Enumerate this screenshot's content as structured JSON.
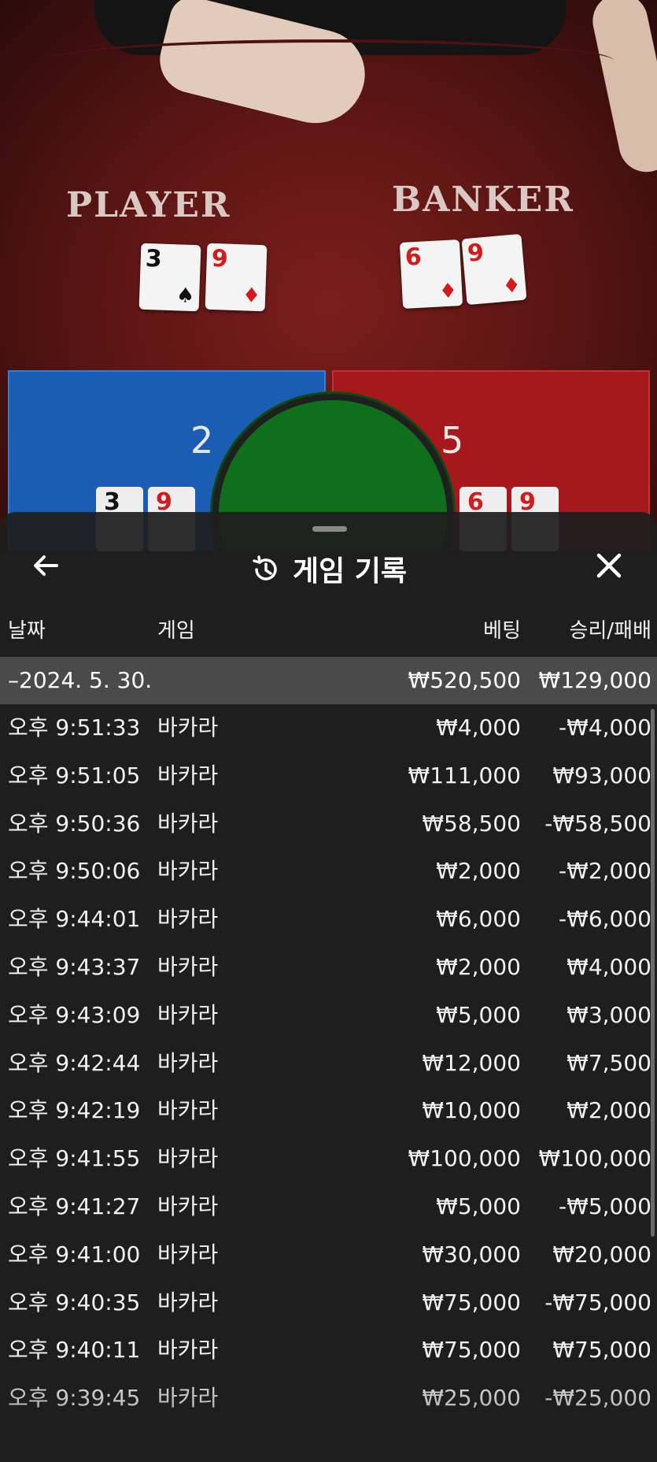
{
  "table": {
    "player_label": "PLAYER",
    "banker_label": "BANKER",
    "player_cards": [
      {
        "rank": "3",
        "suit": "♠",
        "color": "blk"
      },
      {
        "rank": "9",
        "suit": "♦",
        "color": "red"
      }
    ],
    "banker_cards": [
      {
        "rank": "6",
        "suit": "♦",
        "color": "red"
      },
      {
        "rank": "9",
        "suit": "♦",
        "color": "red"
      }
    ],
    "player_score": "2",
    "banker_score": "5",
    "player_mini": [
      "3",
      "9"
    ],
    "banker_mini": [
      "6",
      "9"
    ]
  },
  "sheet": {
    "title": "게임 기록",
    "back_icon": "arrow-left-icon",
    "close_icon": "close-icon",
    "history_icon": "history-icon",
    "columns": {
      "date": "날짜",
      "game": "게임",
      "bet": "베팅",
      "result": "승리/패배"
    },
    "date_group": {
      "date": "–2024. 5. 30.",
      "bet": "₩520,500",
      "result": "₩129,000"
    },
    "rows": [
      {
        "time": "오후 9:51:33",
        "game": "바카라",
        "bet": "₩4,000",
        "result": "-₩4,000"
      },
      {
        "time": "오후 9:51:05",
        "game": "바카라",
        "bet": "₩111,000",
        "result": "₩93,000"
      },
      {
        "time": "오후 9:50:36",
        "game": "바카라",
        "bet": "₩58,500",
        "result": "-₩58,500"
      },
      {
        "time": "오후 9:50:06",
        "game": "바카라",
        "bet": "₩2,000",
        "result": "-₩2,000"
      },
      {
        "time": "오후 9:44:01",
        "game": "바카라",
        "bet": "₩6,000",
        "result": "-₩6,000"
      },
      {
        "time": "오후 9:43:37",
        "game": "바카라",
        "bet": "₩2,000",
        "result": "₩4,000"
      },
      {
        "time": "오후 9:43:09",
        "game": "바카라",
        "bet": "₩5,000",
        "result": "₩3,000"
      },
      {
        "time": "오후 9:42:44",
        "game": "바카라",
        "bet": "₩12,000",
        "result": "₩7,500"
      },
      {
        "time": "오후 9:42:19",
        "game": "바카라",
        "bet": "₩10,000",
        "result": "₩2,000"
      },
      {
        "time": "오후 9:41:55",
        "game": "바카라",
        "bet": "₩100,000",
        "result": "₩100,000"
      },
      {
        "time": "오후 9:41:27",
        "game": "바카라",
        "bet": "₩5,000",
        "result": "-₩5,000"
      },
      {
        "time": "오후 9:41:00",
        "game": "바카라",
        "bet": "₩30,000",
        "result": "₩20,000"
      },
      {
        "time": "오후 9:40:35",
        "game": "바카라",
        "bet": "₩75,000",
        "result": "-₩75,000"
      },
      {
        "time": "오후 9:40:11",
        "game": "바카라",
        "bet": "₩75,000",
        "result": "₩75,000"
      },
      {
        "time": "오후 9:39:45",
        "game": "바카라",
        "bet": "₩25,000",
        "result": "-₩25,000"
      }
    ]
  }
}
